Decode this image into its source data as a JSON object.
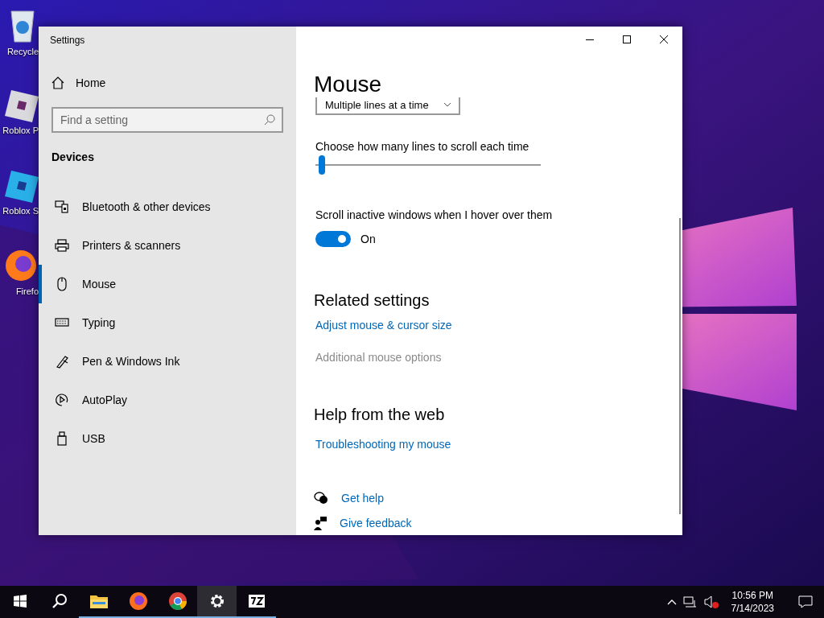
{
  "desktop_icons": [
    {
      "label": "Recycle",
      "kind": "recycle"
    },
    {
      "label": "Roblox P",
      "kind": "roblox"
    },
    {
      "label": "Roblox S",
      "kind": "studio"
    },
    {
      "label": "Firefo",
      "kind": "firefox"
    }
  ],
  "window": {
    "title": "Settings"
  },
  "sidebar": {
    "home": "Home",
    "search": {
      "placeholder": "Find a setting"
    },
    "section": "Devices",
    "items": [
      {
        "label": "Bluetooth & other devices",
        "kind": "bluetooth",
        "selected": false
      },
      {
        "label": "Printers & scanners",
        "kind": "printer",
        "selected": false
      },
      {
        "label": "Mouse",
        "kind": "mouse",
        "selected": true
      },
      {
        "label": "Typing",
        "kind": "keyboard",
        "selected": false
      },
      {
        "label": "Pen & Windows Ink",
        "kind": "pen",
        "selected": false
      },
      {
        "label": "AutoPlay",
        "kind": "autoplay",
        "selected": false
      },
      {
        "label": "USB",
        "kind": "usb",
        "selected": false
      }
    ]
  },
  "page": {
    "title": "Mouse",
    "dropdown": {
      "value": "Multiple lines at a time"
    },
    "slider": {
      "label": "Choose how many lines to scroll each time",
      "level": 0.03
    },
    "toggle": {
      "label": "Scroll inactive windows when I hover over them",
      "on": true,
      "state_text": "On"
    },
    "related": {
      "title": "Related settings",
      "links": [
        {
          "label": "Adjust mouse & cursor size",
          "hovered": false
        },
        {
          "label": "Additional mouse options",
          "hovered": true
        }
      ]
    },
    "help": {
      "title": "Help from the web",
      "links": [
        {
          "label": "Troubleshooting my mouse"
        }
      ]
    },
    "footer_links": [
      {
        "label": "Get help",
        "kind": "help"
      },
      {
        "label": "Give feedback",
        "kind": "feedback"
      }
    ]
  },
  "taskbar": {
    "apps": [
      {
        "kind": "start",
        "open": false,
        "selected": false
      },
      {
        "kind": "search",
        "open": false,
        "selected": false
      },
      {
        "kind": "folder",
        "open": true,
        "selected": false
      },
      {
        "kind": "firefox",
        "open": true,
        "selected": false
      },
      {
        "kind": "chrome",
        "open": true,
        "selected": false
      },
      {
        "kind": "settings",
        "open": true,
        "selected": true
      },
      {
        "kind": "sevenzip",
        "open": true,
        "selected": false
      }
    ],
    "time": "10:56 PM",
    "date": "7/14/2023"
  }
}
